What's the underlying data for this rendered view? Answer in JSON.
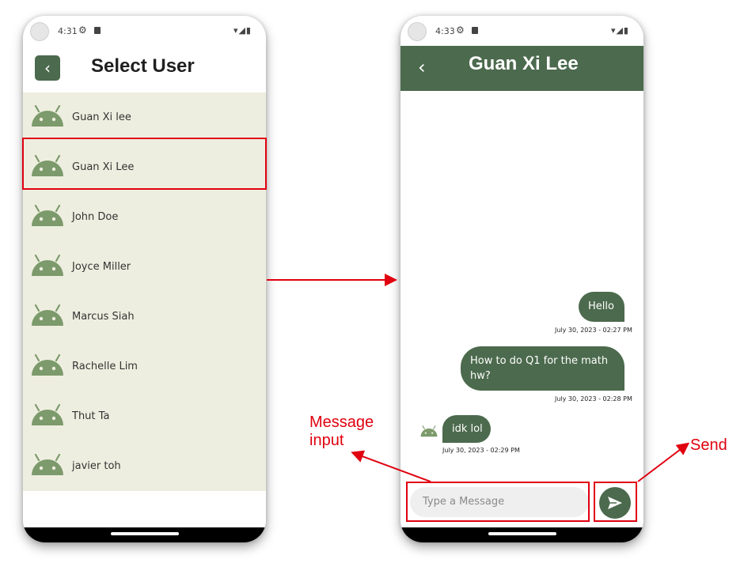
{
  "left_screen": {
    "status_time": "4:31",
    "title": "Select User",
    "users": [
      "Guan Xi lee",
      "Guan Xi Lee",
      "John Doe",
      "Joyce Miller",
      "Marcus Siah",
      "Rachelle Lim",
      "Thut Ta",
      "javier toh"
    ]
  },
  "right_screen": {
    "status_time": "4:33",
    "chat_title": "Guan Xi Lee",
    "messages": [
      {
        "text": "Hello",
        "timestamp": "July 30, 2023 - 02:27 PM",
        "sender": "me"
      },
      {
        "text": "How to do Q1 for the math hw?",
        "timestamp": "July 30, 2023 - 02:28 PM",
        "sender": "me"
      },
      {
        "text": "idk lol",
        "timestamp": "July 30, 2023 - 02:29 PM",
        "sender": "other"
      }
    ],
    "input_placeholder": "Type a Message"
  },
  "annotations": {
    "message_input_label_line1": "Message",
    "message_input_label_line2": "input",
    "send_label": "Send"
  },
  "colors": {
    "accent": "#4c6a4d",
    "list_bg": "#eeeee0",
    "annotation": "#e0000f"
  },
  "icons": [
    "back-arrow-icon",
    "android-robot-icon",
    "send-icon",
    "settings-gear-icon",
    "wifi-icon",
    "signal-icon",
    "battery-icon"
  ]
}
